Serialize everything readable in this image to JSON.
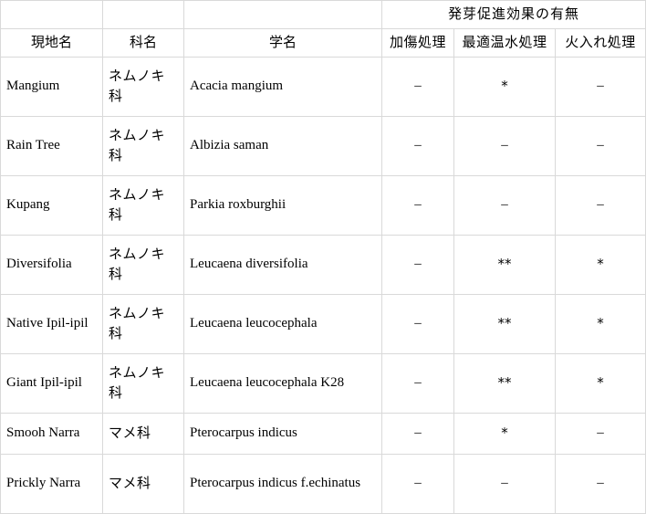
{
  "table": {
    "group_header": "発芽促進効果の有無",
    "headers": {
      "local_name": "現地名",
      "family_name": "科名",
      "scientific_name": "学名",
      "scarification": "加傷処理",
      "hot_water": "最適温水処理",
      "fire": "火入れ処理"
    },
    "rows": [
      {
        "local_name": "Mangium",
        "family_name": "ネムノキ科",
        "scientific_name": "Acacia mangium",
        "scarification": "–",
        "hot_water": "*",
        "fire": "–"
      },
      {
        "local_name": "Rain Tree",
        "family_name": "ネムノキ科",
        "scientific_name": "Albizia saman",
        "scarification": "–",
        "hot_water": "–",
        "fire": "–"
      },
      {
        "local_name": "Kupang",
        "family_name": "ネムノキ科",
        "scientific_name": "Parkia roxburghii",
        "scarification": "–",
        "hot_water": "–",
        "fire": "–"
      },
      {
        "local_name": "Diversifolia",
        "family_name": "ネムノキ科",
        "scientific_name": "Leucaena diversifolia",
        "scarification": "–",
        "hot_water": "**",
        "fire": "*"
      },
      {
        "local_name": "Native Ipil-ipil",
        "family_name": "ネムノキ科",
        "scientific_name": "Leucaena leucocephala",
        "scarification": "–",
        "hot_water": "**",
        "fire": "*"
      },
      {
        "local_name": "Giant Ipil-ipil",
        "family_name": "ネムノキ科",
        "scientific_name": "Leucaena leucocephala K28",
        "scarification": "–",
        "hot_water": "**",
        "fire": "*"
      },
      {
        "local_name": "Smooh Narra",
        "family_name": "マメ科",
        "scientific_name": "Pterocarpus indicus",
        "scarification": "–",
        "hot_water": "*",
        "fire": "–"
      },
      {
        "local_name": "Prickly Narra",
        "family_name": "マメ科",
        "scientific_name": "Pterocarpus indicus f.echinatus",
        "scarification": "–",
        "hot_water": "–",
        "fire": "–"
      }
    ]
  }
}
